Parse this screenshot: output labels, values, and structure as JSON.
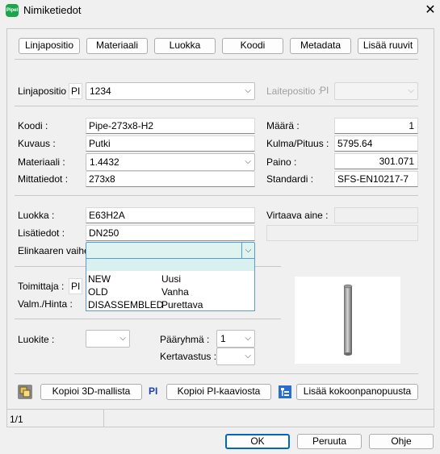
{
  "window": {
    "title": "Nimiketiedot",
    "app_icon_text": "PipeI"
  },
  "tabs": [
    "Linjapositio",
    "Materiaali",
    "Luokka",
    "Koodi",
    "Metadata",
    "Lisää ruuvit"
  ],
  "line": {
    "label": "Linjapositio :",
    "pi": "PI",
    "value": "1234",
    "device_label": "Laitepositio :",
    "device_pi": "PI",
    "device_value": ""
  },
  "item": {
    "code_label": "Koodi :",
    "code": "Pipe-273x8-H2",
    "desc_label": "Kuvaus :",
    "desc": "Putki",
    "material_label": "Materiaali :",
    "material": "1.4432",
    "dims_label": "Mittatiedot :",
    "dims": "273x8",
    "qty_label": "Määrä :",
    "qty": "1",
    "angle_label": "Kulma/Pituus :",
    "angle": "5795.64",
    "weight_label": "Paino :",
    "weight": "301.071",
    "std_label": "Standardi :",
    "std": "SFS-EN10217-7"
  },
  "cls": {
    "class_label": "Luokka :",
    "class": "E63H2A",
    "extra_label": "Lisätiedot :",
    "extra": "DN250",
    "lifecycle_label": "Elinkaaren vaihe :",
    "lifecycle": "",
    "fluid_label": "Virtaava aine :",
    "fluid": ""
  },
  "lifecycle_options": [
    {
      "code": "",
      "name": ""
    },
    {
      "code": "NEW",
      "name": "Uusi"
    },
    {
      "code": "OLD",
      "name": "Vanha"
    },
    {
      "code": "DISASSEMBLED",
      "name": "Purettava"
    }
  ],
  "supplier": {
    "label": "Toimittaja :",
    "pi": "PI",
    "price_label": "Valm./Hinta :"
  },
  "grouping": {
    "luokite_label": "Luokite :",
    "luokite": "",
    "main_group_label": "Pääryhmä :",
    "main_group": "1",
    "multiplier_label": "Kertavastus :",
    "multiplier": ""
  },
  "actions": {
    "copy_3d": "Kopioi 3D-mallista",
    "pi_mark": "PI",
    "copy_pi": "Kopioi PI-kaaviosta",
    "add_tree": "Lisää kokoonpanopuusta"
  },
  "status": {
    "page": "1/1"
  },
  "footer": {
    "ok": "OK",
    "cancel": "Peruuta",
    "help": "Ohje"
  },
  "colors": {
    "accent": "#0067c0",
    "dropdown_highlight": "#d8f1ee",
    "app_icon": "#1aa64a"
  }
}
